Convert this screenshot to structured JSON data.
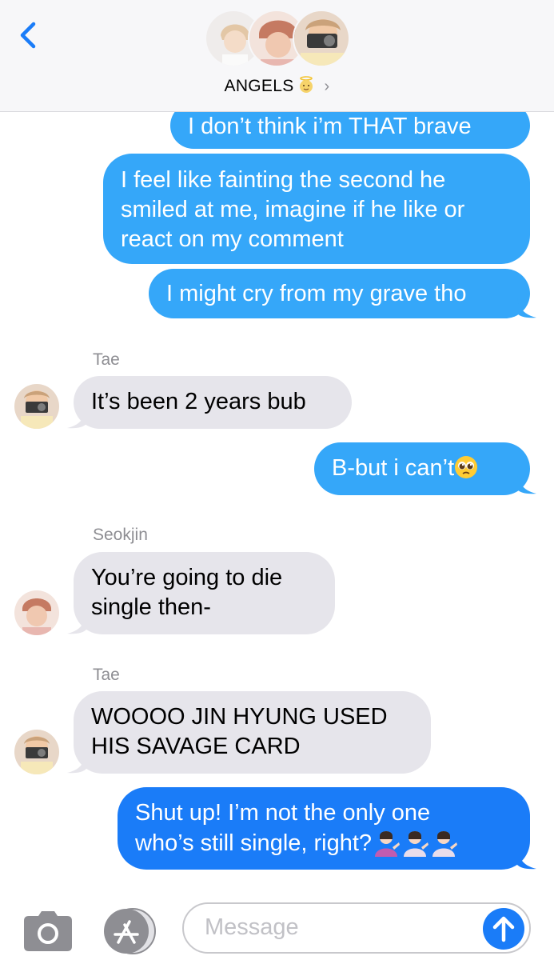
{
  "header": {
    "back_label": "<",
    "group_name": "ANGELS",
    "group_emoji": "angel-face-icon",
    "chevron": "›"
  },
  "messages": [
    {
      "type": "out",
      "text": "I don’t think i’m THAT brave"
    },
    {
      "type": "out",
      "lines": [
        "I feel like fainting the second he",
        "smiled at me, imagine if he like or",
        "react on my comment"
      ]
    },
    {
      "type": "out",
      "text": "I might cry from my grave tho"
    },
    {
      "type": "in",
      "sender": "Tae",
      "text": "It’s been 2 years bub"
    },
    {
      "type": "out",
      "text": "B-but i can’t",
      "emoji": "pleading-face-icon"
    },
    {
      "type": "in",
      "sender": "Seokjin",
      "lines": [
        "You’re going to die",
        "single then-"
      ]
    },
    {
      "type": "in",
      "sender": "Tae",
      "lines": [
        "WOOOO JIN HYUNG USED",
        "HIS SAVAGE CARD"
      ]
    },
    {
      "type": "out",
      "lines": [
        "Shut up! I’m not the only one",
        "who’s still single, right?"
      ],
      "emoji": "person-tipping-hand-icon"
    }
  ],
  "footer": {
    "placeholder": "Message",
    "camera_icon": "camera-icon",
    "apps_icon": "app-store-icon",
    "send_icon": "send-arrow-icon"
  },
  "colors": {
    "outgoing": "#35a7f9",
    "outgoing_dark": "#1a7cf8",
    "incoming": "#e6e5eb",
    "header_bg": "#f7f7f9"
  }
}
